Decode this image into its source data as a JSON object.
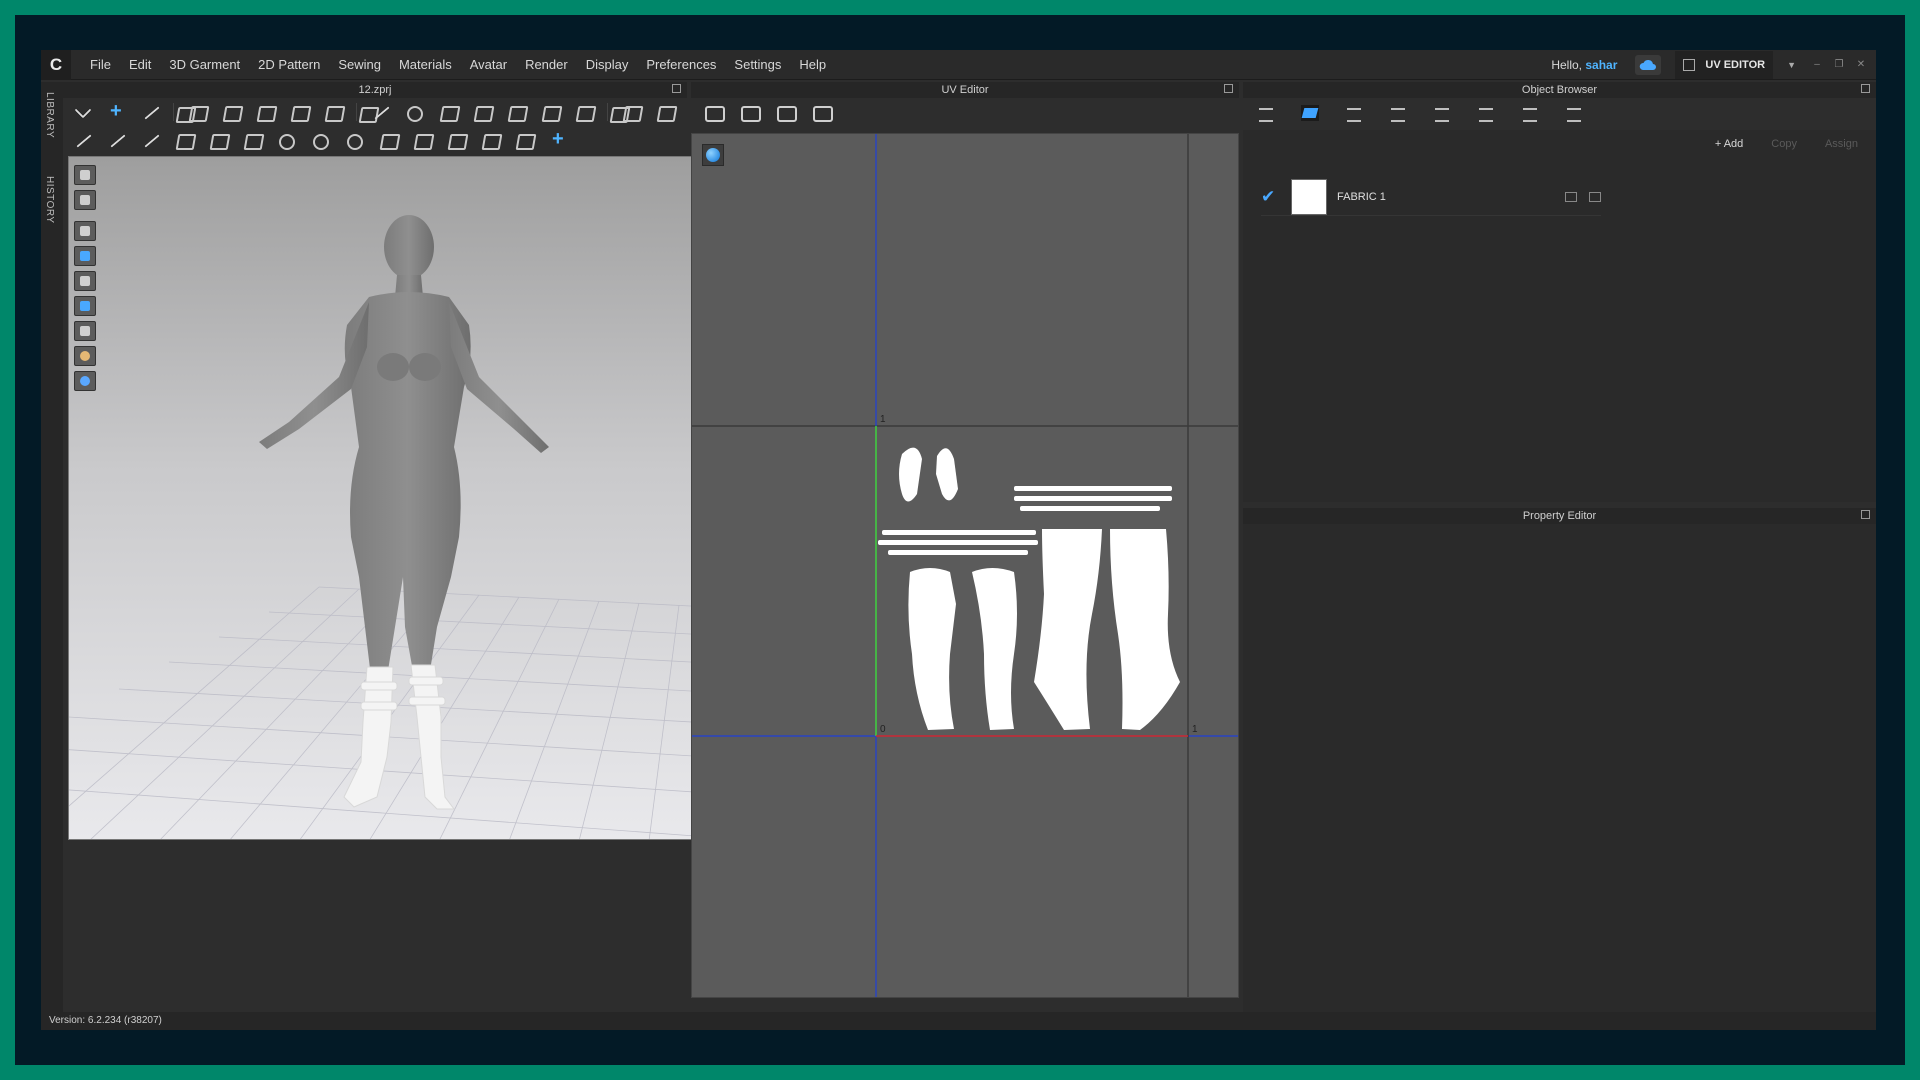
{
  "app": {
    "menu": [
      "File",
      "Edit",
      "3D Garment",
      "2D Pattern",
      "Sewing",
      "Materials",
      "Avatar",
      "Render",
      "Display",
      "Preferences",
      "Settings",
      "Help"
    ],
    "greeting": "Hello,",
    "username": "sahar",
    "mode": "UV EDITOR",
    "version": "Version: 6.2.234 (r38207)"
  },
  "sidebar_tabs": {
    "library": "LIBRARY",
    "history": "HISTORY"
  },
  "viewport3d": {
    "title": "12.zprj"
  },
  "uv_editor": {
    "title": "UV Editor",
    "labels": {
      "top": "1",
      "origin": "0",
      "right": "1"
    }
  },
  "object_browser": {
    "title": "Object Browser",
    "actions": {
      "add": "+ Add",
      "copy": "Copy",
      "assign": "Assign"
    },
    "fabrics": [
      {
        "name": "FABRIC 1",
        "color": "#ffffff"
      }
    ]
  },
  "property_editor": {
    "title": "Property Editor"
  },
  "colors": {
    "frame": "#00876a",
    "accent": "#49a8ff",
    "uv_bg": "#5b5b5b",
    "axis_green": "#3fd13f",
    "axis_red": "#d12a2a",
    "axis_blue": "#1f3fd8"
  }
}
